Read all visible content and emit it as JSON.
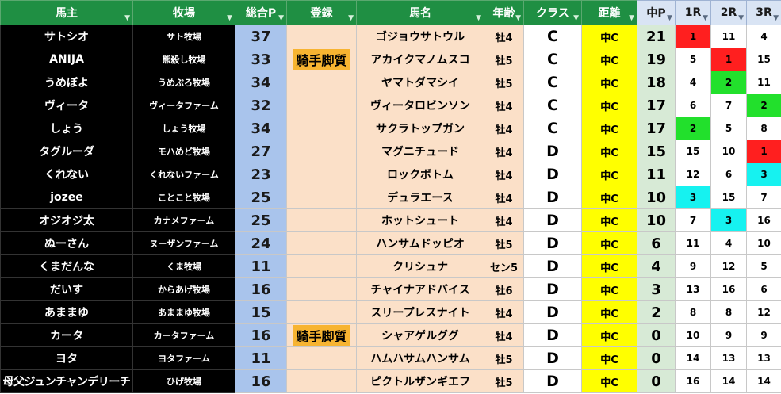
{
  "headers": {
    "owner": "馬主",
    "farm": "牧場",
    "total": "総合P",
    "reg": "登録",
    "horse": "馬名",
    "age": "年齢",
    "cls": "クラス",
    "dist": "距離",
    "mp": "中P",
    "r1": "1R",
    "r2": "2R",
    "r3": "3R"
  },
  "colors": {
    "header_green": "#1f8f43",
    "header_blue": "#d9e4f4",
    "total_blue": "#a9c4ec",
    "peach": "#fbe0c8",
    "badge_orange": "#f7b431",
    "distance_yellow": "#ffff00",
    "midp_green": "#d7ead6",
    "red": "#ff1f1f",
    "green": "#22e02c",
    "cyan": "#16f2f0"
  },
  "rows": [
    {
      "owner": "サトシオ",
      "farm": "サト牧場",
      "total": "37",
      "reg": "",
      "horse": "ゴジョウサトウル",
      "age": "牡4",
      "cls": "C",
      "dist": "中C",
      "mp": "21",
      "r1": "1",
      "r2": "11",
      "r3": "4",
      "r1c": "red",
      "r2c": "",
      "r3c": ""
    },
    {
      "owner": "ANIJA",
      "farm": "熊殺し牧場",
      "total": "33",
      "reg": "騎手脚質",
      "horse": "アカイクマノムスコ",
      "age": "牡5",
      "cls": "C",
      "dist": "中C",
      "mp": "19",
      "r1": "5",
      "r2": "1",
      "r3": "15",
      "r1c": "",
      "r2c": "red",
      "r3c": ""
    },
    {
      "owner": "うめぼよ",
      "farm": "うめぶろ牧場",
      "total": "34",
      "reg": "",
      "horse": "ヤマトダマシイ",
      "age": "牡5",
      "cls": "C",
      "dist": "中C",
      "mp": "18",
      "r1": "4",
      "r2": "2",
      "r3": "11",
      "r1c": "",
      "r2c": "green",
      "r3c": ""
    },
    {
      "owner": "ヴィータ",
      "farm": "ヴィータファーム",
      "total": "32",
      "reg": "",
      "horse": "ヴィータロビンソン",
      "age": "牡4",
      "cls": "C",
      "dist": "中C",
      "mp": "17",
      "r1": "6",
      "r2": "7",
      "r3": "2",
      "r1c": "",
      "r2c": "",
      "r3c": "green"
    },
    {
      "owner": "しょう",
      "farm": "しょう牧場",
      "total": "34",
      "reg": "",
      "horse": "サクラトップガン",
      "age": "牡4",
      "cls": "C",
      "dist": "中C",
      "mp": "17",
      "r1": "2",
      "r2": "5",
      "r3": "8",
      "r1c": "green",
      "r2c": "",
      "r3c": ""
    },
    {
      "owner": "タグルーダ",
      "farm": "モハめど牧場",
      "total": "27",
      "reg": "",
      "horse": "マグニチュード",
      "age": "牡4",
      "cls": "D",
      "dist": "中C",
      "mp": "15",
      "r1": "15",
      "r2": "10",
      "r3": "1",
      "r1c": "",
      "r2c": "",
      "r3c": "red"
    },
    {
      "owner": "くれない",
      "farm": "くれないファーム",
      "total": "23",
      "reg": "",
      "horse": "ロックボトム",
      "age": "牡4",
      "cls": "D",
      "dist": "中C",
      "mp": "11",
      "r1": "12",
      "r2": "6",
      "r3": "3",
      "r1c": "",
      "r2c": "",
      "r3c": "cyan"
    },
    {
      "owner": "jozee",
      "farm": "ことこと牧場",
      "total": "25",
      "reg": "",
      "horse": "デュラエース",
      "age": "牡4",
      "cls": "D",
      "dist": "中C",
      "mp": "10",
      "r1": "3",
      "r2": "15",
      "r3": "7",
      "r1c": "cyan",
      "r2c": "",
      "r3c": ""
    },
    {
      "owner": "オジオジ太",
      "farm": "カナメファーム",
      "total": "25",
      "reg": "",
      "horse": "ホットシュート",
      "age": "牡4",
      "cls": "D",
      "dist": "中C",
      "mp": "10",
      "r1": "7",
      "r2": "3",
      "r3": "16",
      "r1c": "",
      "r2c": "cyan",
      "r3c": ""
    },
    {
      "owner": "ぬーさん",
      "farm": "ヌーザンファーム",
      "total": "24",
      "reg": "",
      "horse": "ハンサムドッピオ",
      "age": "牡5",
      "cls": "D",
      "dist": "中C",
      "mp": "6",
      "r1": "11",
      "r2": "4",
      "r3": "10",
      "r1c": "",
      "r2c": "",
      "r3c": ""
    },
    {
      "owner": "くまだんな",
      "farm": "くま牧場",
      "total": "11",
      "reg": "",
      "horse": "クリシュナ",
      "age": "セン5",
      "cls": "D",
      "dist": "中C",
      "mp": "4",
      "r1": "9",
      "r2": "12",
      "r3": "5",
      "r1c": "",
      "r2c": "",
      "r3c": ""
    },
    {
      "owner": "だいす",
      "farm": "からあげ牧場",
      "total": "16",
      "reg": "",
      "horse": "チャイナアドバイス",
      "age": "牡6",
      "cls": "D",
      "dist": "中C",
      "mp": "3",
      "r1": "13",
      "r2": "16",
      "r3": "6",
      "r1c": "",
      "r2c": "",
      "r3c": ""
    },
    {
      "owner": "あままゆ",
      "farm": "あままゆ牧場",
      "total": "15",
      "reg": "",
      "horse": "スリープレスナイト",
      "age": "牡4",
      "cls": "D",
      "dist": "中C",
      "mp": "2",
      "r1": "8",
      "r2": "8",
      "r3": "12",
      "r1c": "",
      "r2c": "",
      "r3c": ""
    },
    {
      "owner": "カータ",
      "farm": "カータファーム",
      "total": "16",
      "reg": "騎手脚質",
      "horse": "シャアゲルググ",
      "age": "牡4",
      "cls": "D",
      "dist": "中C",
      "mp": "0",
      "r1": "10",
      "r2": "9",
      "r3": "9",
      "r1c": "",
      "r2c": "",
      "r3c": ""
    },
    {
      "owner": "ヨタ",
      "farm": "ヨタファーム",
      "total": "11",
      "reg": "",
      "horse": "ハムハサムハンサム",
      "age": "牡5",
      "cls": "D",
      "dist": "中C",
      "mp": "0",
      "r1": "14",
      "r2": "13",
      "r3": "13",
      "r1c": "",
      "r2c": "",
      "r3c": ""
    },
    {
      "owner": "母父ジュンチャンデリーチ",
      "farm": "ひげ牧場",
      "total": "16",
      "reg": "",
      "horse": "ピクトルザンギエフ",
      "age": "牡5",
      "cls": "D",
      "dist": "中C",
      "mp": "0",
      "r1": "16",
      "r2": "14",
      "r3": "14",
      "r1c": "",
      "r2c": "",
      "r3c": ""
    }
  ]
}
